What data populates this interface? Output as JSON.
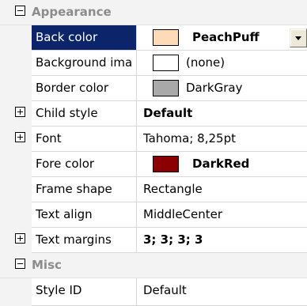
{
  "categories": {
    "appearance": {
      "label": "Appearance",
      "expanded": true
    },
    "misc": {
      "label": "Misc",
      "expanded": true
    }
  },
  "properties": {
    "back_color": {
      "name": "Back color",
      "value": "PeachPuff",
      "swatch": "#ffdab9",
      "selected": true
    },
    "background_image": {
      "name": "Background ima",
      "value": "(none)",
      "swatch": "#ffffff"
    },
    "border_color": {
      "name": "Border color",
      "value": "DarkGray",
      "swatch": "#a9a9a9"
    },
    "child_style": {
      "name": "Child style",
      "value": "Default",
      "expandable": true
    },
    "font": {
      "name": "Font",
      "value": "Tahoma; 8,25pt",
      "expandable": true
    },
    "fore_color": {
      "name": "Fore color",
      "value": "DarkRed",
      "swatch": "#8b0000"
    },
    "frame_shape": {
      "name": "Frame shape",
      "value": "Rectangle"
    },
    "text_align": {
      "name": "Text align",
      "value": "MiddleCenter"
    },
    "text_margins": {
      "name": "Text margins",
      "value": "3; 3; 3; 3",
      "expandable": true
    },
    "style_id": {
      "name": "Style ID",
      "value": "Default"
    }
  },
  "icons": {
    "collapse": "minus-box-icon",
    "expand": "plus-box-icon",
    "dropdown": "chevron-down-icon"
  }
}
